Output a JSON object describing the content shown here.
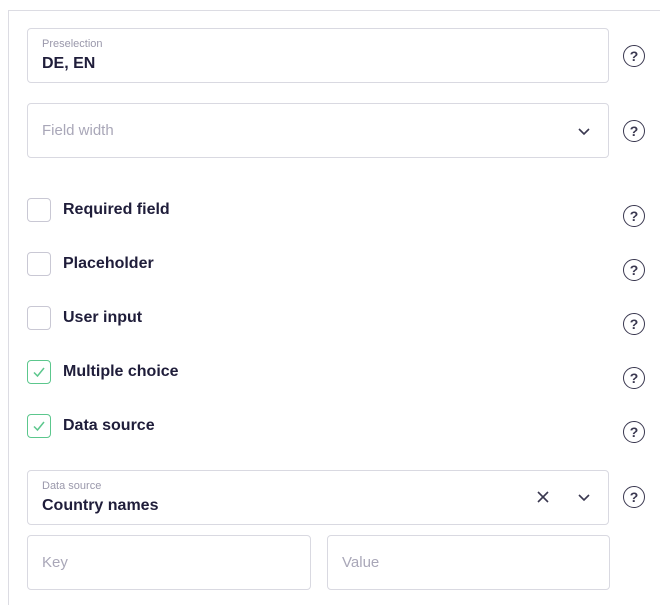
{
  "preselection": {
    "label": "Preselection",
    "value": "DE, EN"
  },
  "field_width": {
    "placeholder": "Field width"
  },
  "checkboxes": [
    {
      "label": "Required field",
      "checked": false
    },
    {
      "label": "Placeholder",
      "checked": false
    },
    {
      "label": "User input",
      "checked": false
    },
    {
      "label": "Multiple choice",
      "checked": true
    },
    {
      "label": "Data source",
      "checked": true
    }
  ],
  "data_source": {
    "label": "Data source",
    "value": "Country names"
  },
  "key_field": {
    "placeholder": "Key"
  },
  "value_field": {
    "placeholder": "Value"
  },
  "help_icon_glyph": "?",
  "colors": {
    "check_accent": "#5cc78d",
    "text": "#1f1d3a",
    "placeholder": "#a9a7b8",
    "border": "#d9d9e1"
  }
}
